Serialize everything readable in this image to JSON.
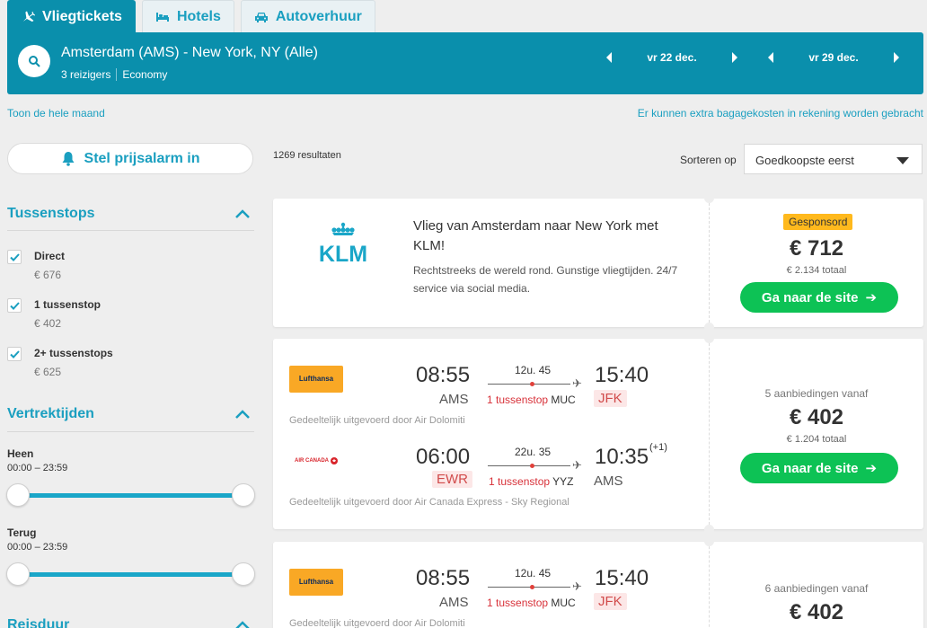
{
  "tabs": [
    {
      "label": "Vliegtickets",
      "icon": "plane-icon",
      "active": true
    },
    {
      "label": "Hotels",
      "icon": "bed-icon",
      "active": false
    },
    {
      "label": "Autoverhuur",
      "icon": "car-icon",
      "active": false
    }
  ],
  "search": {
    "route": "Amsterdam (AMS) - New York, NY (Alle)",
    "travelers": "3 reizigers",
    "cabin": "Economy",
    "depart_date": "vr 22 dec.",
    "return_date": "vr 29 dec."
  },
  "links": {
    "whole_month": "Toon de hele maand",
    "baggage": "Er kunnen extra bagagekosten in rekening worden gebracht"
  },
  "sidebar": {
    "alarm_label": "Stel prijsalarm in",
    "stops_title": "Tussenstops",
    "stops": [
      {
        "name": "Direct",
        "price": "€ 676",
        "checked": true
      },
      {
        "name": "1 tussenstop",
        "price": "€ 402",
        "checked": true
      },
      {
        "name": "2+ tussenstops",
        "price": "€ 625",
        "checked": true
      }
    ],
    "times_title": "Vertrektijden",
    "outbound_label": "Heen",
    "outbound_range": "00:00 – 23:59",
    "return_label": "Terug",
    "return_range": "00:00 – 23:59",
    "duration_title": "Reisduur"
  },
  "results": {
    "count": "1269 resultaten",
    "sort_label": "Sorteren op",
    "sort_value": "Goedkoopste eerst"
  },
  "ad": {
    "logo_text": "KLM",
    "title": "Vlieg van Amsterdam naar New York met KLM!",
    "description": "Rechtstreeks de wereld rond. Gunstige vliegtijden. 24/7 service via social media.",
    "badge": "Gesponsord",
    "price": "€ 712",
    "total": "€ 2.134 totaal",
    "cta": "Ga naar de site"
  },
  "result1": {
    "outbound": {
      "airline": "Lufthansa",
      "dep_time": "08:55",
      "dep_apt": "AMS",
      "duration": "12u. 45",
      "stops": "1 tussenstop",
      "via": "MUC",
      "arr_time": "15:40",
      "arr_apt": "JFK",
      "operated": "Gedeeltelijk uitgevoerd door Air Dolomiti"
    },
    "return": {
      "airline": "AIR CANADA",
      "dep_time": "06:00",
      "dep_apt": "EWR",
      "duration": "22u. 35",
      "stops": "1 tussenstop",
      "via": "YYZ",
      "arr_time": "10:35",
      "arr_plus": "(+1)",
      "arr_apt": "AMS",
      "operated": "Gedeeltelijk uitgevoerd door Air Canada Express - Sky Regional"
    },
    "offers": "5 aanbiedingen vanaf",
    "price": "€ 402",
    "total": "€ 1.204 totaal",
    "cta": "Ga naar de site"
  },
  "result2": {
    "outbound": {
      "airline": "Lufthansa",
      "dep_time": "08:55",
      "dep_apt": "AMS",
      "duration": "12u. 45",
      "stops": "1 tussenstop",
      "via": "MUC",
      "arr_time": "15:40",
      "arr_apt": "JFK",
      "operated": "Gedeeltelijk uitgevoerd door Air Dolomiti"
    },
    "offers": "6 aanbiedingen vanaf",
    "price": "€ 402"
  },
  "colors": {
    "accent": "#0a8fac",
    "link": "#1a9fc0",
    "cta": "#0dc255",
    "sponsored": "#ffb91d",
    "stop_red": "#d8323a",
    "lufthansa": "#f9a825"
  }
}
